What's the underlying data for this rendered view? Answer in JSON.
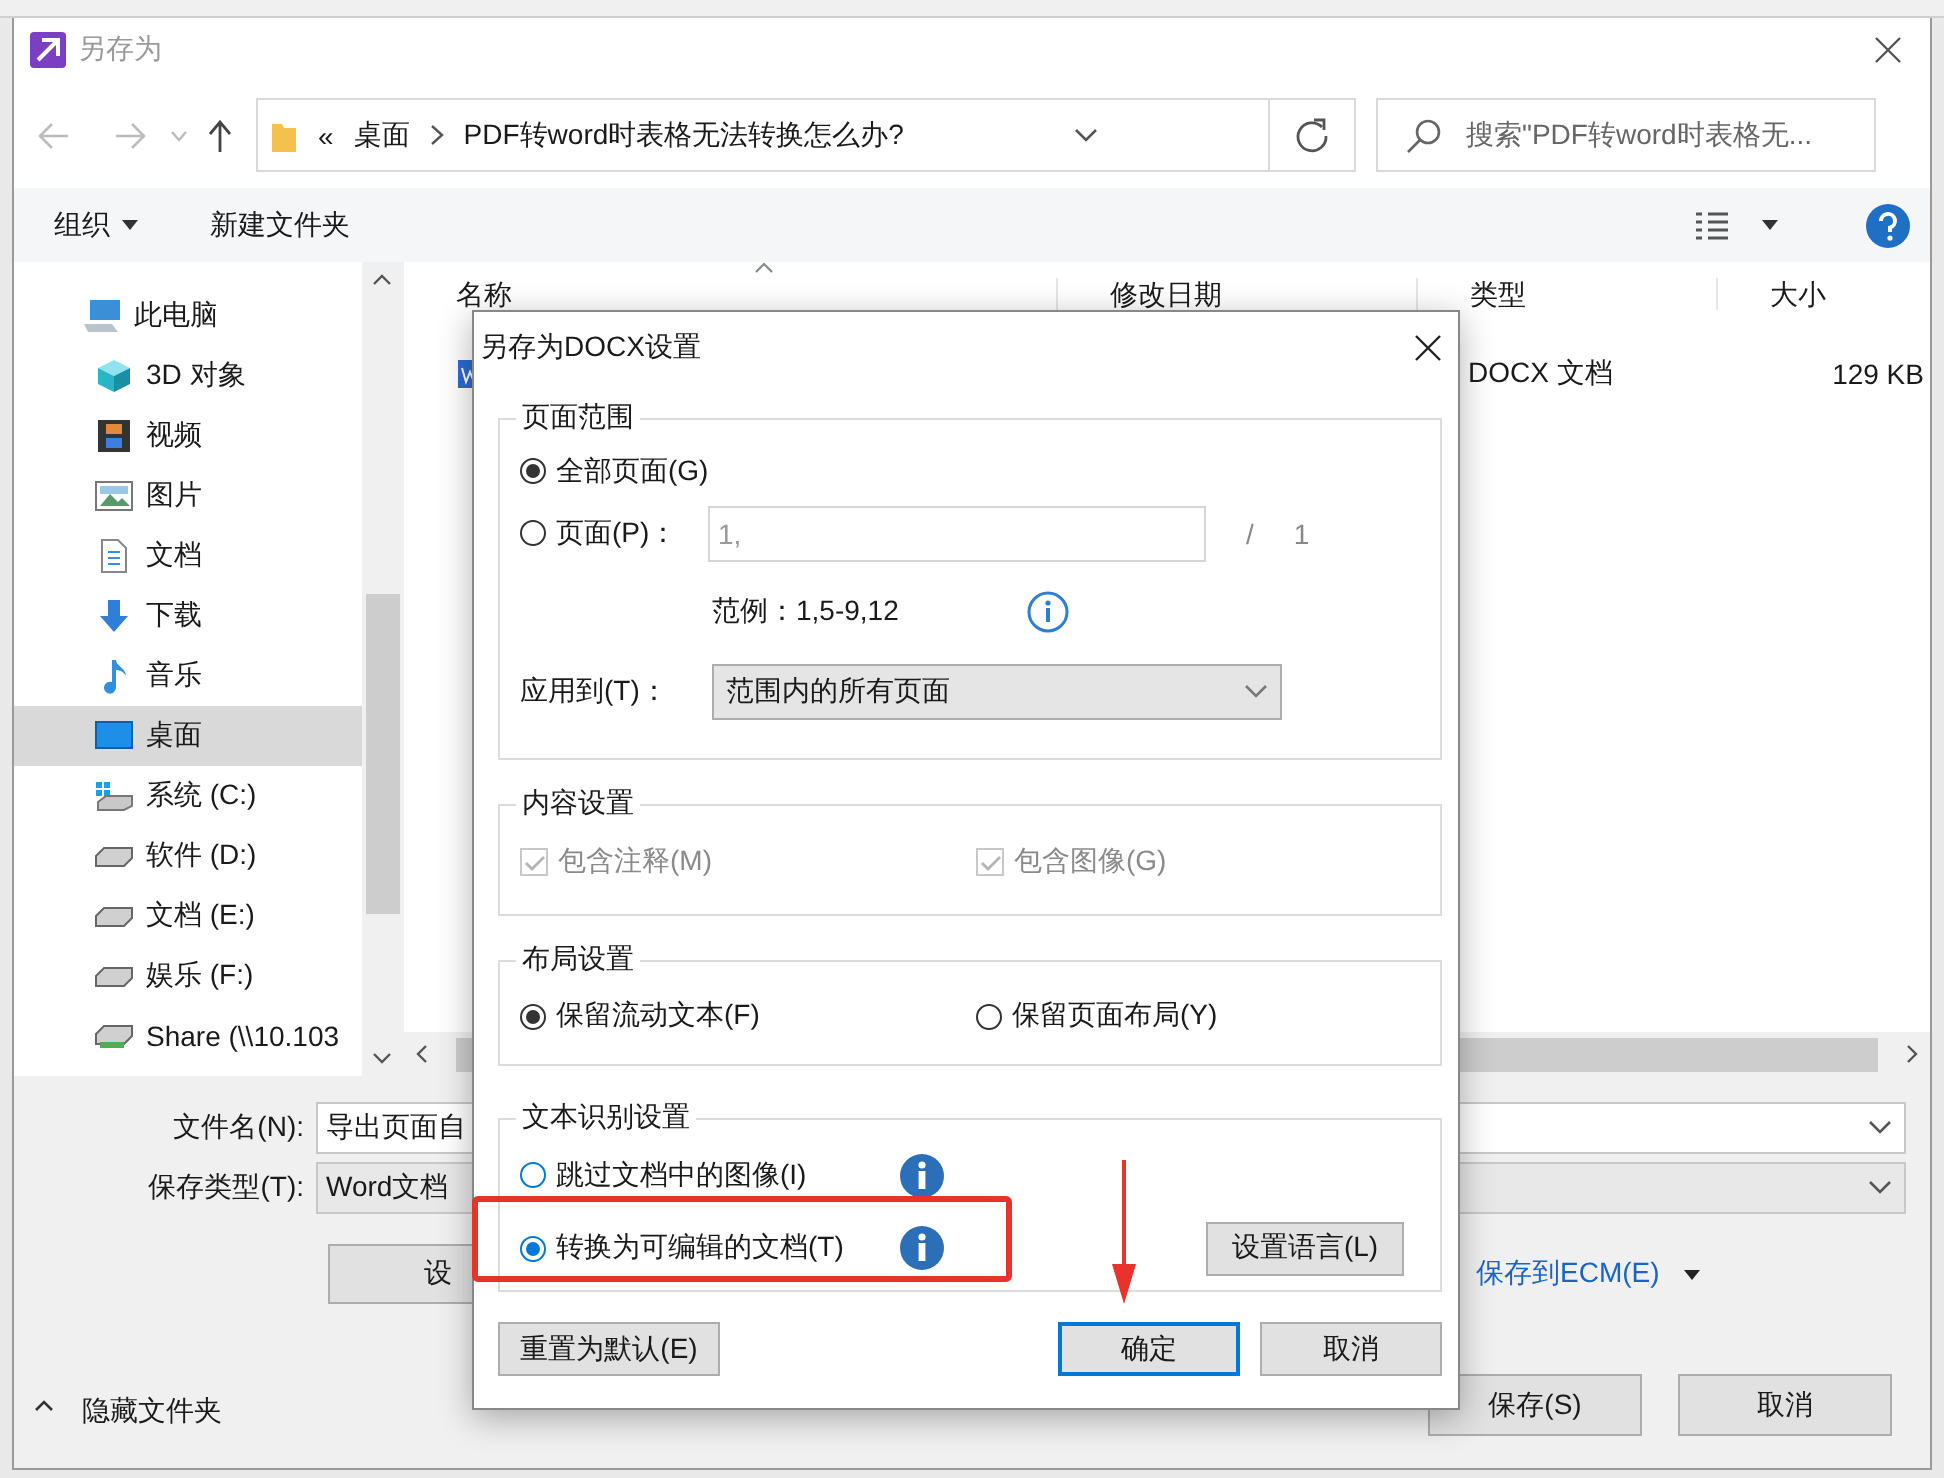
{
  "window": {
    "title": "另存为"
  },
  "address": {
    "overflow": "«",
    "crumbs": [
      "桌面",
      "PDF转word时表格无法转换怎么办?"
    ]
  },
  "search": {
    "placeholder": "搜索\"PDF转word时表格无..."
  },
  "toolbar": {
    "organize": "组织",
    "new_folder": "新建文件夹"
  },
  "sidebar": {
    "items": [
      {
        "label": "此电脑",
        "kind": "pc",
        "selected": false,
        "children": [
          {
            "label": "3D 对象",
            "kind": "cube",
            "selected": false
          },
          {
            "label": "视频",
            "kind": "film",
            "selected": false
          },
          {
            "label": "图片",
            "kind": "picture",
            "selected": false
          },
          {
            "label": "文档",
            "kind": "document",
            "selected": false
          },
          {
            "label": "下载",
            "kind": "download",
            "selected": false
          },
          {
            "label": "音乐",
            "kind": "music",
            "selected": false
          },
          {
            "label": "桌面",
            "kind": "desktop",
            "selected": true
          },
          {
            "label": "系统 (C:)",
            "kind": "system-drive",
            "selected": false
          },
          {
            "label": "软件 (D:)",
            "kind": "drive",
            "selected": false
          },
          {
            "label": "文档 (E:)",
            "kind": "drive",
            "selected": false
          },
          {
            "label": "娱乐 (F:)",
            "kind": "drive",
            "selected": false
          },
          {
            "label": "Share (\\\\10.103",
            "kind": "network-drive",
            "selected": false
          }
        ]
      }
    ]
  },
  "file_list": {
    "columns": [
      "名称",
      "修改日期",
      "类型",
      "大小"
    ],
    "rows": [
      {
        "type": "DOCX 文档",
        "size": "129 KB"
      }
    ]
  },
  "form": {
    "file_name": {
      "label": "文件名(N):",
      "value": "导出页面自"
    },
    "save_type": {
      "label": "保存类型(T):",
      "value": "Word文档"
    },
    "settings_button": "设",
    "ecm_link": "保存到ECM(E)",
    "hide_folders": "隐藏文件夹",
    "save_button": "保存(S)",
    "cancel_button": "取消"
  },
  "dialog": {
    "title": "另存为DOCX设置",
    "page_range": {
      "title": "页面范围",
      "options": [
        {
          "label": "全部页面(G)",
          "selected": true
        },
        {
          "label": "页面(P)：",
          "selected": false
        }
      ],
      "pages_value": "1,",
      "separator": "/",
      "total": "1",
      "example": "范例：1,5-9,12",
      "apply_label": "应用到(T)：",
      "apply_value": "范围内的所有页面"
    },
    "content": {
      "title": "内容设置",
      "checkboxes": [
        {
          "label": "包含注释(M)",
          "checked": true,
          "disabled": true
        },
        {
          "label": "包含图像(G)",
          "checked": true,
          "disabled": true
        }
      ]
    },
    "layout": {
      "title": "布局设置",
      "options": [
        {
          "label": "保留流动文本(F)",
          "selected": true
        },
        {
          "label": "保留页面布局(Y)",
          "selected": false
        }
      ]
    },
    "ocr": {
      "title": "文本识别设置",
      "options": [
        {
          "label": "跳过文档中的图像(I)",
          "selected": false,
          "highlighted": false
        },
        {
          "label": "转换为可编辑的文档(T)",
          "selected": true,
          "highlighted": true
        }
      ],
      "language_button": "设置语言(L)"
    },
    "buttons": [
      {
        "label": "重置为默认(E)",
        "default": false
      },
      {
        "label": "确定",
        "default": true
      },
      {
        "label": "取消",
        "default": false
      }
    ]
  }
}
